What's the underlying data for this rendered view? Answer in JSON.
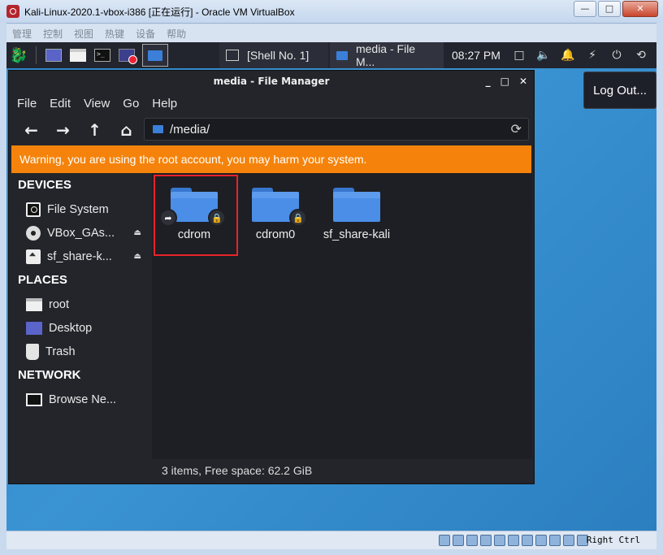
{
  "host": {
    "title": "Kali-Linux-2020.1-vbox-i386 [正在运行] - Oracle VM VirtualBox",
    "menu": [
      "管理",
      "控制",
      "视图",
      "热键",
      "设备",
      "帮助"
    ],
    "window_buttons": [
      "—",
      "□",
      "✕"
    ],
    "host_key": "Right Ctrl"
  },
  "panel": {
    "tasks": [
      {
        "label": "[Shell No. 1]",
        "icon": "terminal-icon"
      },
      {
        "label": "media - File M...",
        "icon": "folder-icon"
      }
    ],
    "clock": "08:27 PM",
    "tray": [
      "□",
      "🔈",
      "🔔",
      "⚡",
      "⏻",
      "⟲"
    ]
  },
  "logout_popup": {
    "label": "Log Out..."
  },
  "file_manager": {
    "title": "media - File Manager",
    "title_controls": [
      "_",
      "□",
      "✕"
    ],
    "menu": [
      "File",
      "Edit",
      "View",
      "Go",
      "Help"
    ],
    "toolbar": {
      "back": "←",
      "forward": "→",
      "up": "↑",
      "home": "⌂",
      "reload": "⟳"
    },
    "path": "/media/",
    "warning": "Warning, you are using the root account, you may harm your system.",
    "sidebar": {
      "devices_header": "DEVICES",
      "devices": [
        {
          "label": "File System",
          "icon": "harddisk-icon",
          "eject": ""
        },
        {
          "label": "VBox_GAs...",
          "icon": "optical-disc-icon",
          "eject": "⏏"
        },
        {
          "label": "sf_share-k...",
          "icon": "removable-drive-icon",
          "eject": "⏏"
        }
      ],
      "places_header": "PLACES",
      "places": [
        {
          "label": "root",
          "icon": "home-folder-icon"
        },
        {
          "label": "Desktop",
          "icon": "desktop-icon"
        },
        {
          "label": "Trash",
          "icon": "trash-icon"
        }
      ],
      "network_header": "NETWORK",
      "network": [
        {
          "label": "Browse Ne...",
          "icon": "network-icon"
        }
      ]
    },
    "files": [
      {
        "name": "cdrom",
        "emblems": [
          "symlink-emblem-icon",
          "lock-emblem-icon"
        ]
      },
      {
        "name": "cdrom0",
        "emblems": [
          "lock-emblem-icon"
        ]
      },
      {
        "name": "sf_share-kali",
        "emblems": []
      }
    ],
    "status": "3 items, Free space: 62.2 GiB"
  },
  "colors": {
    "warning": "#f5830b",
    "folder": "#4a8ee8",
    "highlight": "#e8232a",
    "desktop": "#2d86c9"
  }
}
